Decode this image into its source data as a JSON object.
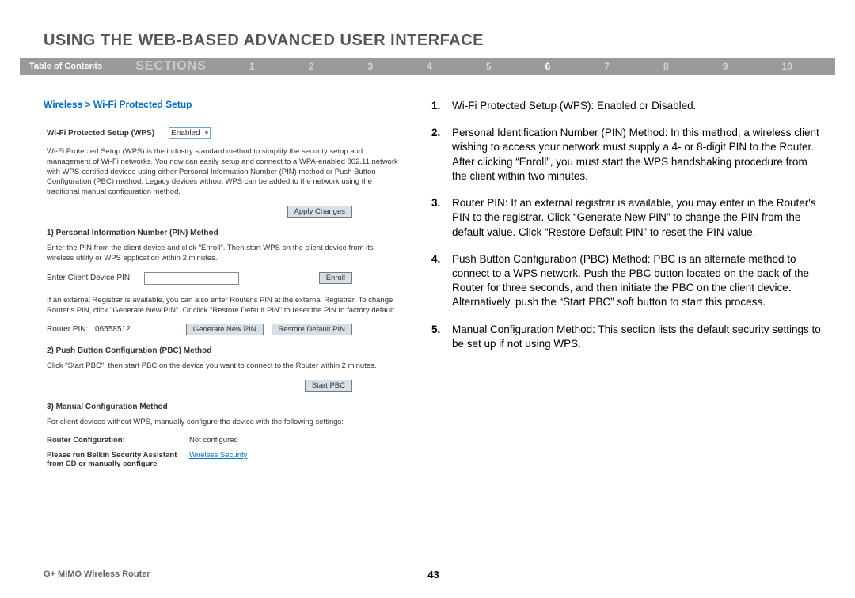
{
  "header": {
    "title": "USING THE WEB-BASED ADVANCED USER INTERFACE"
  },
  "nav": {
    "toc": "Table of Contents",
    "sections_label": "SECTIONS",
    "numbers": [
      "1",
      "2",
      "3",
      "4",
      "5",
      "6",
      "7",
      "8",
      "9",
      "10"
    ],
    "active_index": 5
  },
  "breadcrumb": "Wireless > Wi-Fi Protected Setup",
  "wps": {
    "label": "Wi-Fi Protected Setup (WPS)",
    "select_value": "Enabled",
    "intro": "Wi-Fi Protected Setup (WPS) is the industry standard method to simplify the security setup and management of Wi-Fi networks. You now can easily setup and connect to a WPA-enabled 802.11 network with WPS-certified devices using either Personal Information Number (PIN) method or Push Button Configuration (PBC) method. Legacy devices without WPS can be added to the network using the traditional manual configuration method.",
    "apply_btn": "Apply Changes",
    "pin_head": "1) Personal Information Number (PIN) Method",
    "pin_text": "Enter the PIN from the client device and click \"Enroll\". Then start WPS on the client device from its wireless utility or WPS application within 2 minutes.",
    "pin_label": "Enter Client Device PIN",
    "enroll_btn": "Enroll",
    "registrar_text": "If an external Registrar is available, you can also enter Router's PIN at the external Registrar. To change Router's PIN, click \"Generate New PIN\". Or click \"Restore Default PIN\" to reset the PIN to factory default.",
    "router_pin_label": "Router PIN:",
    "router_pin_value": "06558512",
    "gen_btn": "Generate New PIN",
    "restore_btn": "Restore Default PIN",
    "pbc_head": "2) Push Button Configuration (PBC) Method",
    "pbc_text": "Click \"Start PBC\", then start PBC on the device you want to connect to the Router within 2 minutes.",
    "start_pbc_btn": "Start PBC",
    "manual_head": "3) Manual Configuration Method",
    "manual_text": "For client devices without WPS, manually configure the device with the following settings:",
    "router_config_label": "Router Configuration:",
    "router_config_value": "Not configured",
    "assist_label": "Please run Belkin Security Assistant from CD or manually configure",
    "assist_link": "Wireless Security"
  },
  "instructions": [
    {
      "n": "1.",
      "t": "Wi-Fi Protected Setup (WPS): Enabled or Disabled."
    },
    {
      "n": "2.",
      "t": "Personal Identification Number (PIN) Method: In this method, a wireless client wishing to access your network must supply a 4- or 8-digit PIN to the Router. After clicking “Enroll”, you must start the WPS handshaking procedure from the client within two minutes."
    },
    {
      "n": "3.",
      "t": "Router PIN: If an external registrar is available, you may enter in the Router's PIN to the registrar. Click “Generate New PIN” to change the PIN from the default value. Click “Restore Default PIN” to reset the PIN value."
    },
    {
      "n": "4.",
      "t": "Push Button Configuration (PBC) Method: PBC is an alternate method to connect to a WPS network. Push the PBC button located on the back of the Router for three seconds, and then initiate the PBC on the client device. Alternatively, push the “Start PBC” soft button to start this process."
    },
    {
      "n": "5.",
      "t": "Manual Configuration Method: This section lists the default security settings to be set up if not using WPS."
    }
  ],
  "footer": {
    "product": "G+ MIMO Wireless Router",
    "page": "43"
  }
}
